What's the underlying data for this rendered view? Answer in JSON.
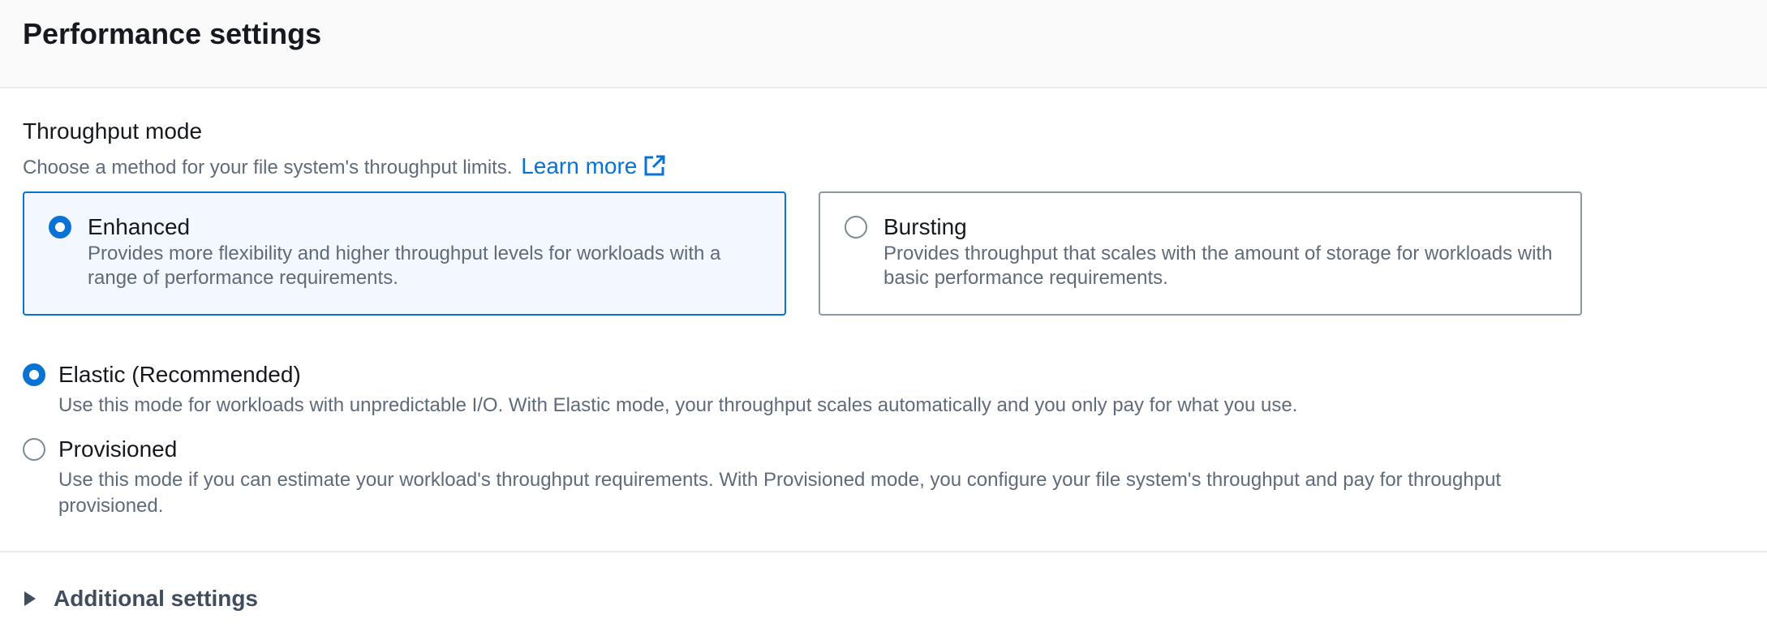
{
  "header": {
    "title": "Performance settings"
  },
  "throughput": {
    "label": "Throughput mode",
    "description": "Choose a method for your file system's throughput limits.",
    "learn_more": "Learn more",
    "tiles": [
      {
        "title": "Enhanced",
        "description": "Provides more flexibility and higher throughput levels for workloads with a range of performance requirements.",
        "selected": true
      },
      {
        "title": "Bursting",
        "description": "Provides throughput that scales with the amount of storage for workloads with basic performance requirements.",
        "selected": false
      }
    ],
    "options": [
      {
        "title": "Elastic (Recommended)",
        "description": "Use this mode for workloads with unpredictable I/O. With Elastic mode, your throughput scales automatically and you only pay for what you use.",
        "selected": true
      },
      {
        "title": "Provisioned",
        "description": "Use this mode if you can estimate your workload's throughput requirements. With Provisioned mode, you configure your file system's throughput and pay for throughput provisioned.",
        "selected": false
      }
    ]
  },
  "additional": {
    "label": "Additional settings",
    "expanded": false
  },
  "colors": {
    "accent": "#0972d3",
    "selected_tile_bg": "#f2f8fd",
    "text_primary": "#16191f",
    "text_secondary": "#5f6b7a"
  },
  "icons": {
    "external_link": "external-link-icon",
    "caret": "caret-right-icon"
  }
}
